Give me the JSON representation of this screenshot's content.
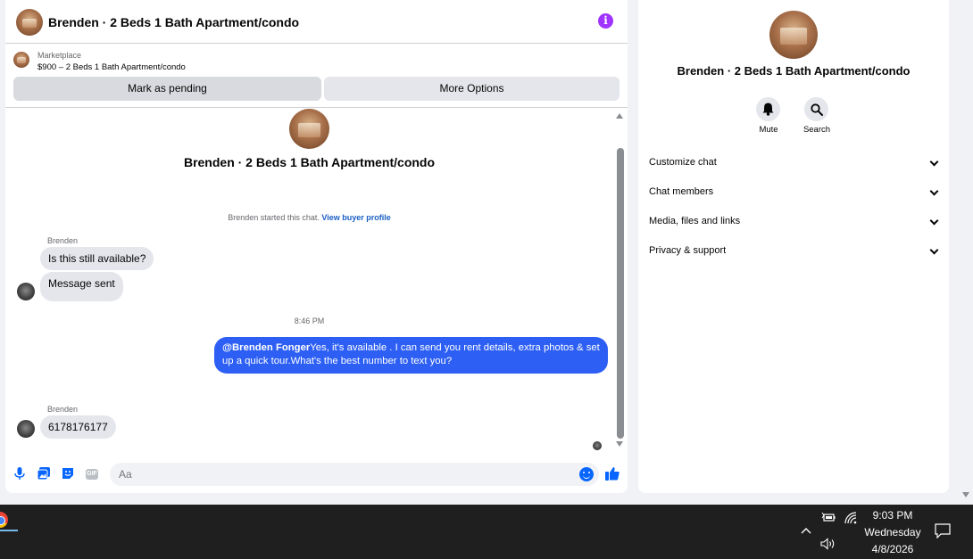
{
  "chat": {
    "header_title": "Brenden · 2 Beds 1 Bath Apartment/condo",
    "info_icon": "i",
    "listing_label": "Marketplace",
    "listing_price": "$900 – 2 Beds 1 Bath Apartment/condo",
    "mark_pending": "Mark as pending",
    "more_options": "More Options",
    "intro_title": "Brenden · 2 Beds 1 Bath Apartment/condo",
    "started_text": "Brenden started this chat.",
    "view_profile": "View buyer profile",
    "messages": [
      {
        "sender": "Brenden",
        "text": "Is this still available?"
      },
      {
        "text": "Message sent"
      }
    ],
    "time": "8:46 PM",
    "reply_mention": "@Brenden Fonger",
    "reply_text": "Yes, it's available .  I can send you rent details, extra photos & set up a quick tour.What's the best number to text you?",
    "last_sender": "Brenden",
    "last_message": "6178176177",
    "composer_placeholder": "Aa"
  },
  "details": {
    "title": "Brenden · 2 Beds 1 Bath Apartment/condo",
    "mute_label": "Mute",
    "search_label": "Search",
    "sections": [
      "Customize chat",
      "Chat members",
      "Media, files and links",
      "Privacy & support"
    ]
  },
  "taskbar": {
    "time": "9:03 PM",
    "day": "Wednesday",
    "date": "4/8/2026"
  },
  "colors": {
    "accent": "#0866ff",
    "outgoing_bubble": "#2d5ff4",
    "info_purple": "#a033ff"
  }
}
